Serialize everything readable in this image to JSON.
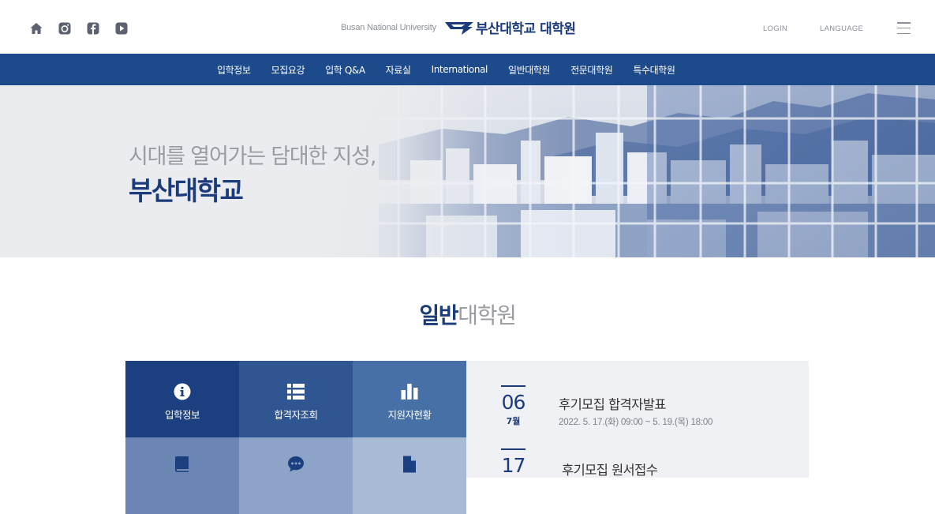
{
  "colors": {
    "primary_navy": "#1d4a8a",
    "title_navy": "#1b3b7a",
    "gray_text": "#9a9ca3",
    "panel_bg": "#f0f1f4"
  },
  "header": {
    "social_icons": [
      "home-icon",
      "instagram-icon",
      "facebook-icon",
      "youtube-icon"
    ],
    "brand_en": "Busan National University",
    "brand_ko": "부산대학교 대학원",
    "login_label": "LOGIN",
    "language_label": "LANGUAGE"
  },
  "nav": {
    "items": [
      {
        "label": "입학정보"
      },
      {
        "label": "모집요강"
      },
      {
        "label": "입학 Q&A"
      },
      {
        "label": "자료실"
      },
      {
        "label": "International"
      },
      {
        "label": "일반대학원"
      },
      {
        "label": "전문대학원"
      },
      {
        "label": "특수대학원"
      }
    ]
  },
  "hero": {
    "line1": "시대를 열어가는 담대한 지성,",
    "line2": "부산대학교"
  },
  "section": {
    "title_strong": "일반",
    "title_light": "대학원"
  },
  "tiles": [
    {
      "label": "입학정보",
      "icon": "info-icon"
    },
    {
      "label": "합격자조회",
      "icon": "list-icon"
    },
    {
      "label": "지원자현황",
      "icon": "bar-chart-icon"
    },
    {
      "label": "",
      "icon": "book-icon"
    },
    {
      "label": "",
      "icon": "chat-bubble-icon"
    },
    {
      "label": "",
      "icon": "document-icon"
    }
  ],
  "notices": [
    {
      "day": "06",
      "month": "7월",
      "title": "후기모집 합격자발표",
      "date": "2022. 5. 17.(화) 09:00 ~ 5. 19.(목) 18:00"
    },
    {
      "day": "17",
      "month": "",
      "title": "후기모집 원서접수",
      "date": ""
    }
  ]
}
